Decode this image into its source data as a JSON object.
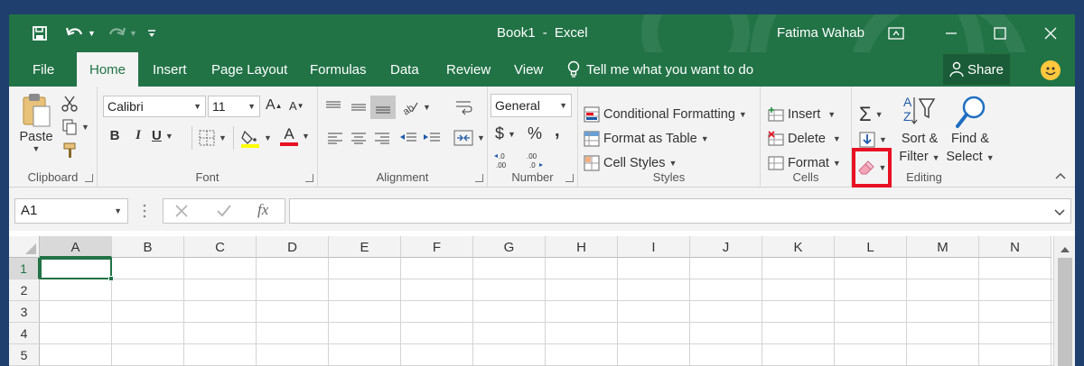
{
  "titlebar": {
    "doc_title": "Book1",
    "separator": "-",
    "app_name": "Excel",
    "user_name": "Fatima Wahab",
    "accent": "#217346"
  },
  "quick_access": {
    "save_icon": "save-icon",
    "undo_icon": "undo-icon",
    "redo_icon": "redo-icon",
    "customize_icon": "customize-qat-icon"
  },
  "tabs": [
    {
      "label": "File"
    },
    {
      "label": "Home"
    },
    {
      "label": "Insert"
    },
    {
      "label": "Page Layout"
    },
    {
      "label": "Formulas"
    },
    {
      "label": "Data"
    },
    {
      "label": "Review"
    },
    {
      "label": "View"
    }
  ],
  "tell_me": "Tell me what you want to do",
  "share_label": "Share",
  "ribbon": {
    "clipboard": {
      "paste": "Paste",
      "group": "Clipboard"
    },
    "font": {
      "name": "Calibri",
      "size": "11",
      "bold": "B",
      "italic": "I",
      "underline": "U",
      "grow": "A",
      "shrink": "A",
      "color_letter": "A",
      "group": "Font"
    },
    "alignment": {
      "group": "Alignment"
    },
    "number": {
      "format": "General",
      "currency": "$",
      "percent": "%",
      "comma": ",",
      "inc_decimal": "←.0 .00",
      "dec_decimal": ".00 →.0",
      "group": "Number"
    },
    "styles": {
      "conditional": "Conditional Formatting",
      "table": "Format as Table",
      "cell_styles": "Cell Styles",
      "group": "Styles"
    },
    "cells": {
      "insert": "Insert",
      "delete": "Delete",
      "format": "Format",
      "group": "Cells"
    },
    "editing": {
      "sigma": "Σ",
      "sort_1": "Sort &",
      "sort_2": "Filter",
      "find_1": "Find &",
      "find_2": "Select",
      "group": "Editing",
      "highlight_color": "#e81123"
    }
  },
  "formula_bar": {
    "name_box": "A1",
    "fx": "fx",
    "value": ""
  },
  "sheet": {
    "columns": [
      "A",
      "B",
      "C",
      "D",
      "E",
      "F",
      "G",
      "H",
      "I",
      "J",
      "K",
      "L",
      "M",
      "N"
    ],
    "rows": [
      "1",
      "2",
      "3",
      "4",
      "5"
    ],
    "selected_cell": "A1"
  }
}
